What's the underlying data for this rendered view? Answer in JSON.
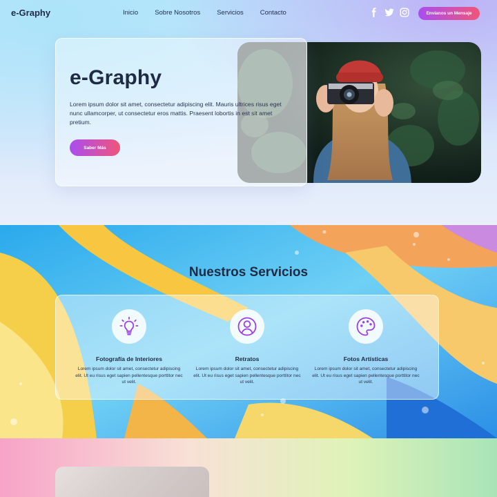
{
  "header": {
    "logo": "e-Graphy",
    "nav": [
      "Inicio",
      "Sobre Nosotros",
      "Servicios",
      "Contacto"
    ],
    "socials": [
      "facebook-icon",
      "twitter-icon",
      "instagram-icon"
    ],
    "cta_label": "Envíanos un Mensaje"
  },
  "hero": {
    "title": "e-Graphy",
    "text": "Lorem ipsum dolor sit amet, consectetur adipiscing elit. Mauris ultrices risus eget nunc ullamcorper, ut consectetur eros mattis. Praesent lobortis in est sit amet pretium.",
    "button_label": "Saber Más",
    "image": "photographer-photo"
  },
  "services": {
    "title": "Nuestros Servicios",
    "items": [
      {
        "icon": "lightbulb-icon",
        "name": "Fotografía de Interiores",
        "text": "Lorem ipsum dolor sit amet, consectetur adipiscing elit. Ut eu risus eget sapien pellentesque porttitor nec ut velit."
      },
      {
        "icon": "user-icon",
        "name": "Retratos",
        "text": "Lorem ipsum dolor sit amet, consectetur adipiscing elit. Ut eu risus eget sapien pellentesque porttitor nec ut velit."
      },
      {
        "icon": "palette-icon",
        "name": "Fotos Artísticas",
        "text": "Lorem ipsum dolor sit amet, consectetur adipiscing elit. Ut eu risus eget sapien pellentesque porttitor nec ut velit."
      }
    ]
  },
  "colors": {
    "accent_start": "#a84ef0",
    "accent_end": "#f0557a",
    "icon_purple": "#9b3fe6",
    "text_dark": "#1f2a44"
  }
}
